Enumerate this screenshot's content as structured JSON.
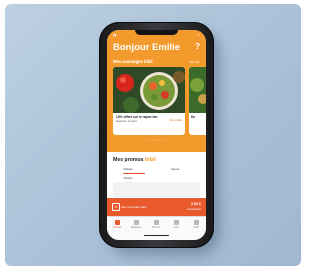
{
  "header": {
    "greeting": "Bonjour Emilie",
    "help_icon": "?",
    "advantages_title": "Mes avantages",
    "advantages_brand": "bibil",
    "see_all": "Voir tout"
  },
  "carousel": {
    "cards": [
      {
        "title": "10% offert sur le rayon bio",
        "subtitle": "Magasins Franprix",
        "action": "J'en profite"
      },
      {
        "title": "De"
      }
    ],
    "dots": "• • • • •"
  },
  "promos": {
    "title": "Mes promos",
    "brand": "bibil",
    "tabs": [
      "Utilisés",
      "Ajouts"
    ],
    "sub_label": "Valides"
  },
  "promo_bar": {
    "badge": "%",
    "label": "Mon compteur bibil",
    "amount": "2,50 €",
    "unit": "économisés"
  },
  "tabbar": {
    "logo": "bibil",
    "items": [
      "Accueil",
      "Magasins",
      "Promos",
      "Liste",
      "Profil"
    ]
  },
  "colors": {
    "accent": "#f39a2c",
    "promo_bar": "#e85a2c",
    "background": "#a9c0d7"
  }
}
